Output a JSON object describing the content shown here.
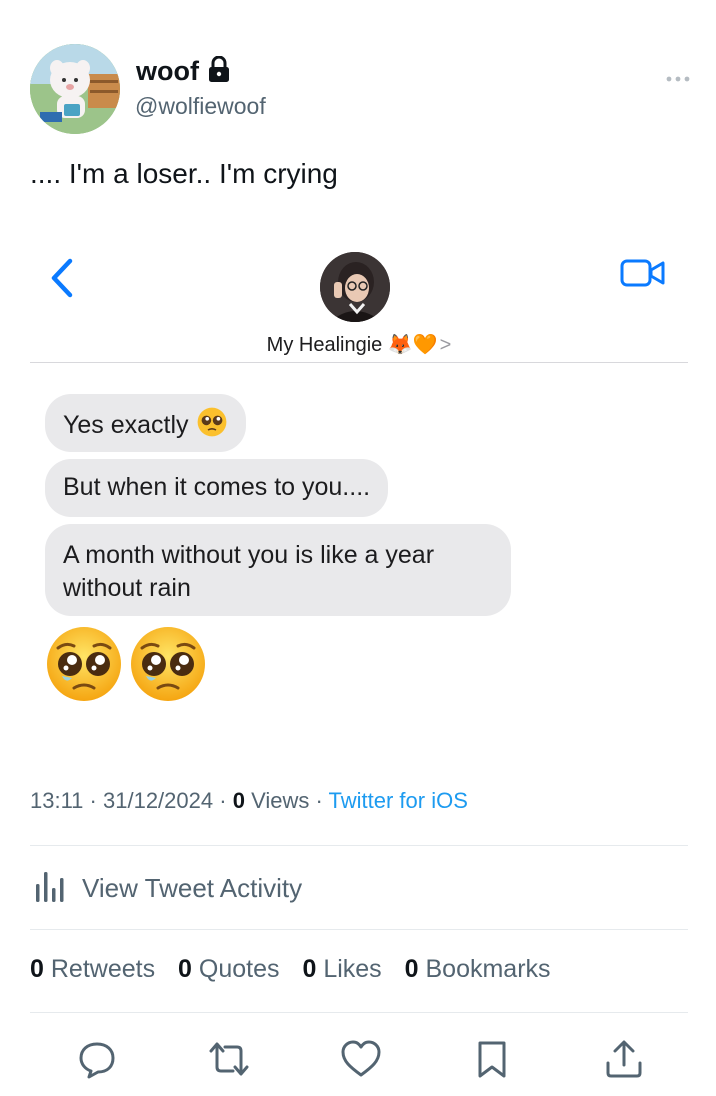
{
  "author": {
    "name": "woof",
    "handle": "@wolfiewoof",
    "locked_icon": "lock-icon"
  },
  "more_icon": "more-dots-icon",
  "tweet": {
    "text": ".... I'm a loser.. I'm crying"
  },
  "screenshot": {
    "contact_name": "My Healingie 🦊🧡",
    "contact_chevron": ">",
    "back_icon": "chevron-left-icon",
    "video_icon": "video-camera-icon",
    "messages": [
      {
        "text": "Yes exactly",
        "emoji": "pleading-face"
      },
      {
        "text": "But when it comes to you...."
      },
      {
        "text": "A month without you is like a year without rain"
      }
    ],
    "big_emoji": [
      "pleading-face",
      "pleading-face"
    ],
    "accent_color": "#0a7aff"
  },
  "meta": {
    "time": "13:11",
    "date": "31/12/2024",
    "views_count": "0",
    "views_label": "Views",
    "source": "Twitter for iOS",
    "separator": "·"
  },
  "activity": {
    "label": "View Tweet Activity",
    "icon": "bar-chart-icon"
  },
  "stats": [
    {
      "count": "0",
      "label": "Retweets"
    },
    {
      "count": "0",
      "label": "Quotes"
    },
    {
      "count": "0",
      "label": "Likes"
    },
    {
      "count": "0",
      "label": "Bookmarks"
    }
  ],
  "actions": [
    "reply-icon",
    "retweet-icon",
    "like-icon",
    "bookmark-icon",
    "share-icon"
  ],
  "colors": {
    "text_primary": "#0f1419",
    "text_secondary": "#536471",
    "link": "#1d9bf0",
    "bubble": "#e9e9eb"
  }
}
